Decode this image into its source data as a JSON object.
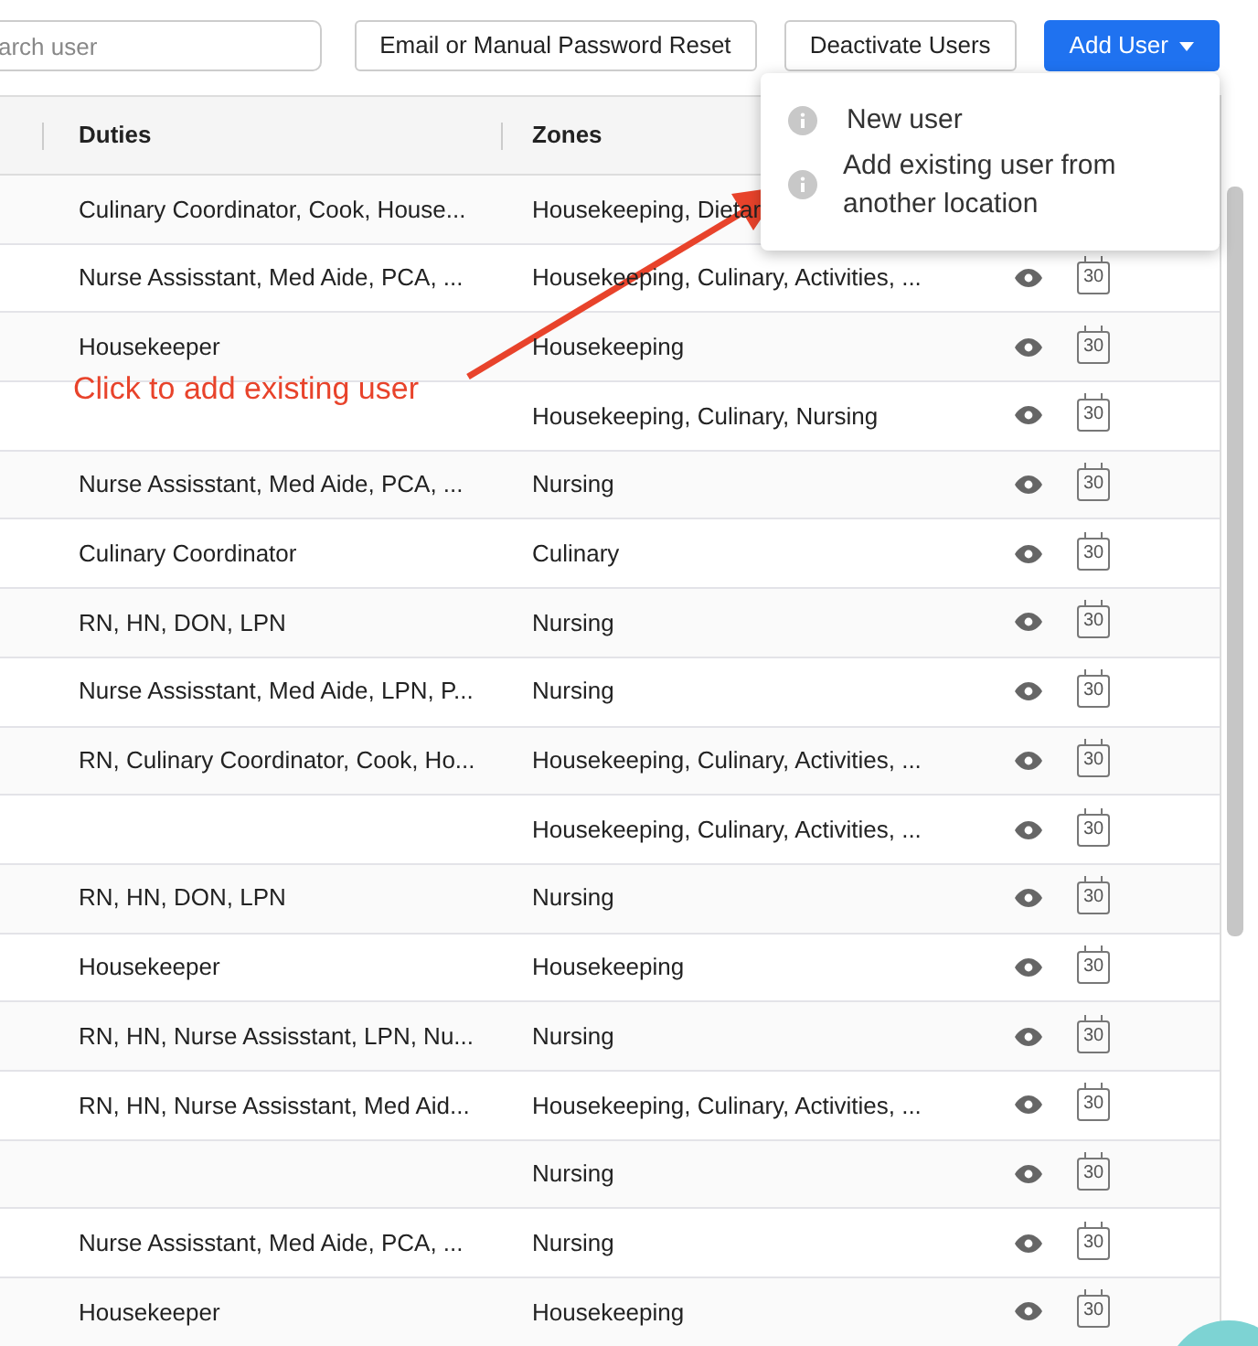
{
  "toolbar": {
    "search": {
      "placeholder": "arch user"
    },
    "buttons": [
      {
        "label": "Email or Manual Password Reset",
        "kind": "outline"
      },
      {
        "label": "Deactivate Users",
        "kind": "outline"
      },
      {
        "label": "Add User",
        "kind": "primary",
        "caret": true
      }
    ]
  },
  "table": {
    "columns": [
      "Duties",
      "Zones"
    ],
    "rows": [
      {
        "duties": "Culinary Coordinator, Cook, House...",
        "zones": "Housekeeping, Dietar",
        "actions": false
      },
      {
        "duties": "Nurse Assisstant, Med Aide, PCA, ...",
        "zones": "Housekeeping, Culinary, Activities, ...",
        "actions": true,
        "calendar": "30"
      },
      {
        "duties": "Housekeeper",
        "zones": "Housekeeping",
        "actions": true,
        "calendar": "30"
      },
      {
        "duties": "",
        "zones": "Housekeeping, Culinary, Nursing",
        "actions": true,
        "calendar": "30"
      },
      {
        "duties": "Nurse Assisstant, Med Aide, PCA, ...",
        "zones": "Nursing",
        "actions": true,
        "calendar": "30"
      },
      {
        "duties": "Culinary Coordinator",
        "zones": "Culinary",
        "actions": true,
        "calendar": "30"
      },
      {
        "duties": "RN, HN, DON, LPN",
        "zones": "Nursing",
        "actions": true,
        "calendar": "30"
      },
      {
        "duties": "Nurse Assisstant, Med Aide, LPN, P...",
        "zones": "Nursing",
        "actions": true,
        "calendar": "30"
      },
      {
        "duties": "RN, Culinary Coordinator, Cook, Ho...",
        "zones": "Housekeeping, Culinary, Activities, ...",
        "actions": true,
        "calendar": "30"
      },
      {
        "duties": "",
        "zones": "Housekeeping, Culinary, Activities, ...",
        "actions": true,
        "calendar": "30"
      },
      {
        "duties": "RN, HN, DON, LPN",
        "zones": "Nursing",
        "actions": true,
        "calendar": "30"
      },
      {
        "duties": "Housekeeper",
        "zones": "Housekeeping",
        "actions": true,
        "calendar": "30"
      },
      {
        "duties": "RN, HN, Nurse Assisstant, LPN, Nu...",
        "zones": "Nursing",
        "actions": true,
        "calendar": "30"
      },
      {
        "duties": "RN, HN, Nurse Assisstant, Med Aid...",
        "zones": "Housekeeping, Culinary, Activities, ...",
        "actions": true,
        "calendar": "30"
      },
      {
        "duties": "",
        "zones": "Nursing",
        "actions": true,
        "calendar": "30"
      },
      {
        "duties": "Nurse Assisstant, Med Aide, PCA, ...",
        "zones": "Nursing",
        "actions": true,
        "calendar": "30"
      },
      {
        "duties": "Housekeeper",
        "zones": "Housekeeping",
        "actions": true,
        "calendar": "30"
      }
    ]
  },
  "dropdown": {
    "items": [
      "New user",
      "Add existing user from another location"
    ]
  },
  "annotation": {
    "text": "Click to add existing user"
  }
}
